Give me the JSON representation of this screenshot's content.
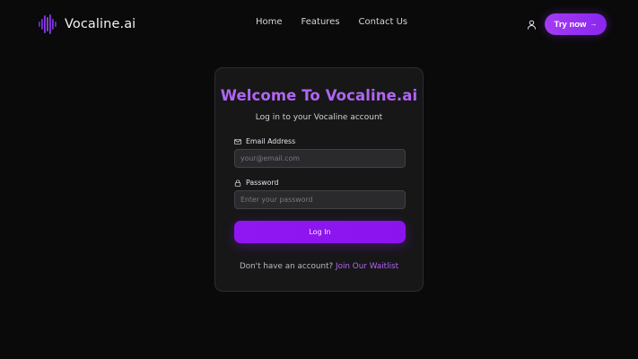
{
  "header": {
    "brand": "Vocaline.ai",
    "logo_icon": "soundwave-icon",
    "nav": [
      {
        "label": "Home"
      },
      {
        "label": "Features"
      },
      {
        "label": "Contact Us"
      }
    ],
    "user_icon": "user-icon",
    "cta_label": "Try now",
    "cta_icon": "arrow-right-icon"
  },
  "login": {
    "title": "Welcome To Vocaline.ai",
    "subtitle": "Log in to your Vocaline account",
    "email": {
      "label": "Email Address",
      "icon": "mail-icon",
      "placeholder": "your@email.com",
      "value": ""
    },
    "password": {
      "label": "Password",
      "icon": "lock-icon",
      "placeholder": "Enter your password",
      "value": ""
    },
    "submit_label": "Log In",
    "signup_prompt": "Don't have an account?",
    "signup_link": "Join Our Waitlist"
  },
  "colors": {
    "background": "#0a0a0b",
    "card": "#171718",
    "accent": "#b065f2",
    "button": "#9016f2"
  }
}
